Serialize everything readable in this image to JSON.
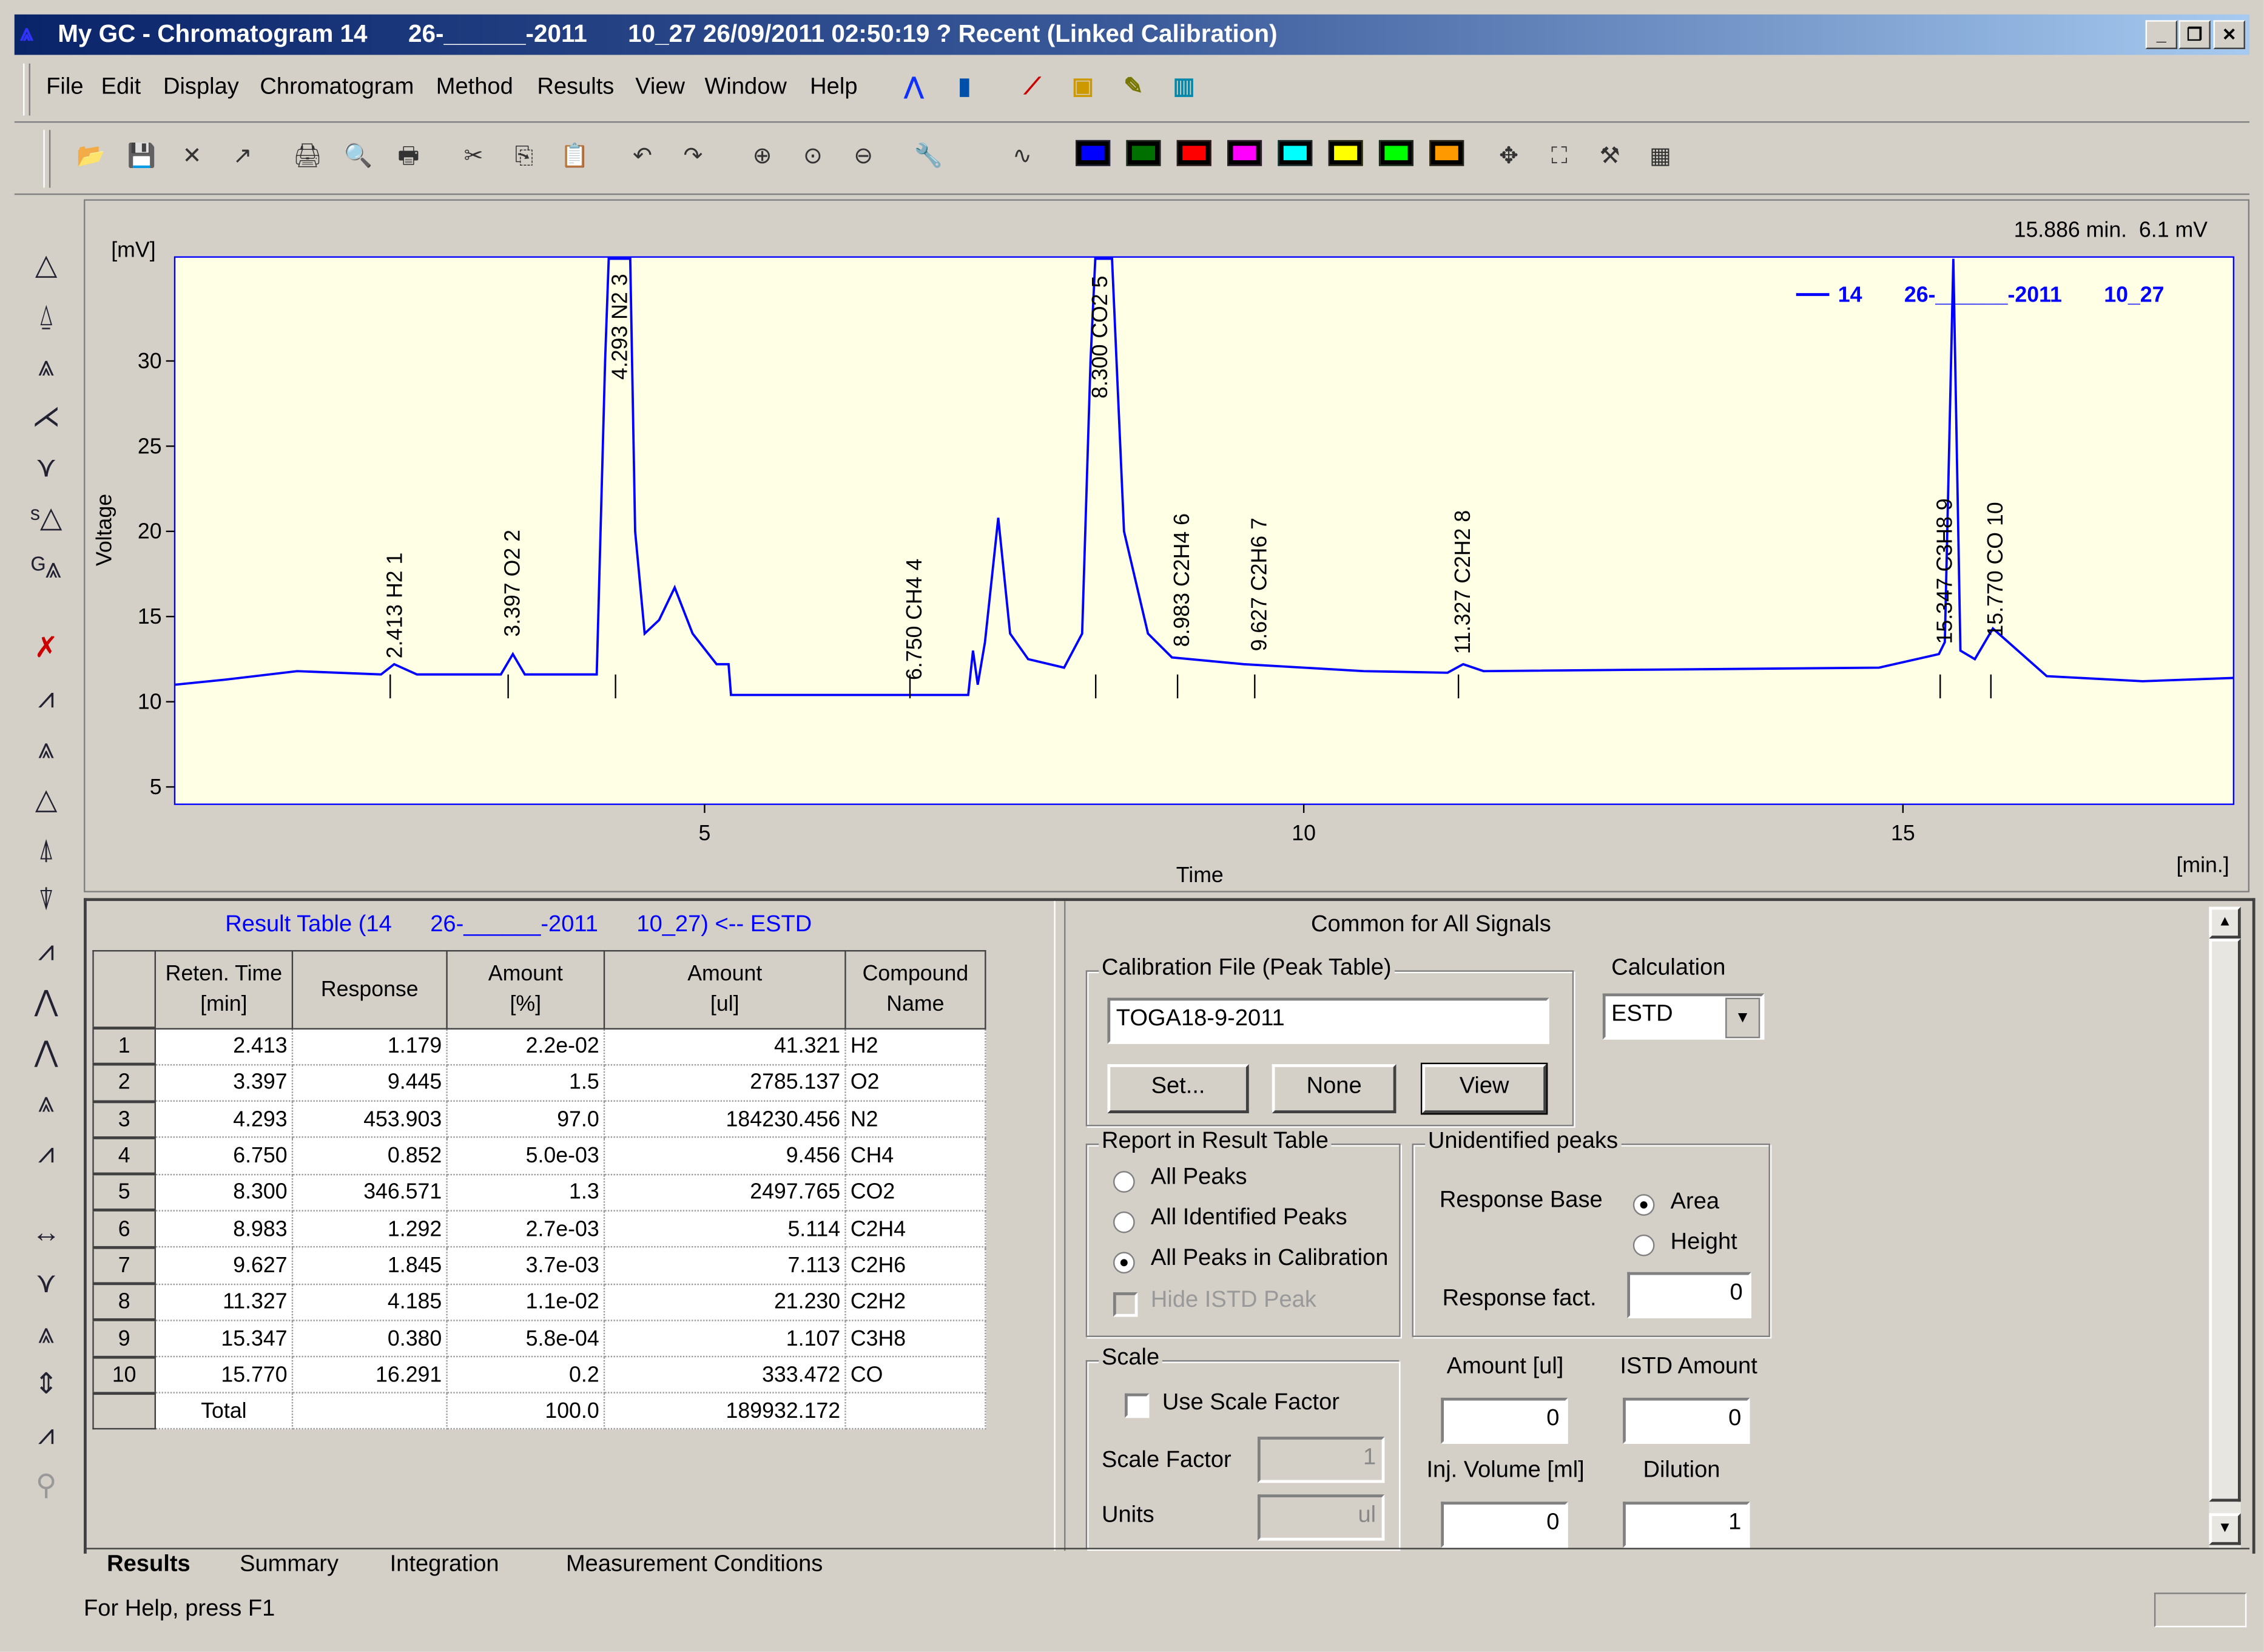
{
  "window": {
    "title": "My GC - Chromatogram 14      26-______-2011      10_27 26/09/2011 02:50:19 ? Recent (Linked Calibration)",
    "minimize": "_",
    "restore": "❐",
    "close": "✕"
  },
  "menu": [
    "File",
    "Edit",
    "Display",
    "Chromatogram",
    "Method",
    "Results",
    "View",
    "Window",
    "Help"
  ],
  "menu_icons": [
    "chromatogram-view-icon",
    "bar-chart-icon",
    "overlay-icon",
    "monitor-icon",
    "edit-method-icon",
    "instrument-icon"
  ],
  "toolbar": {
    "icons": [
      "open-icon",
      "save-icon",
      "delete-icon",
      "export-icon",
      "print-setup-icon",
      "print-preview-icon",
      "print-icon",
      "cut-icon",
      "copy-icon",
      "paste-icon",
      "undo-icon",
      "redo-icon",
      "zoom-in-icon",
      "zoom-icon",
      "zoom-reset-icon",
      "wrench-icon",
      "signal-icon"
    ],
    "color_boxes": [
      "#0000ff",
      "#007000",
      "#ff0000",
      "#ff00ff",
      "#00ffff",
      "#ffff00",
      "#00ff00",
      "#ff9900"
    ],
    "right_icons": [
      "move-icon",
      "fit-icon",
      "tools-icon",
      "table-icon"
    ]
  },
  "left_toolbar": [
    "peak-start-icon",
    "peak-end-icon",
    "split-peak-icon",
    "valley-icon",
    "negative-peak-icon",
    "solvent-peak-icon",
    "group-peak-icon",
    "delete-peak-icon",
    "manual-peak-icon",
    "lock-peak-icon",
    "baseline-icon",
    "forward-horizontal-icon",
    "backward-horizontal-icon",
    "tangent-icon",
    "front-tangent-icon",
    "tail-tangent-icon",
    "integration-event-icon",
    "shift-event-icon",
    "width-icon",
    "negative-baseline-icon",
    "threshold-icon",
    "min-height-icon",
    "noise-icon",
    "disabled-tool-icon"
  ],
  "chart": {
    "cursor_readout": "15.886 min.  6.1 mV",
    "y_unit": "[mV]",
    "y_label": "Voltage",
    "x_label": "Time",
    "x_unit": "[min.]",
    "legend": "14       26-______-2011       10_27",
    "trace_color": "#0000ff",
    "background": "#ffffe6",
    "y_ticks": [
      "5",
      "10",
      "15",
      "20",
      "25",
      "30"
    ],
    "x_ticks": [
      "5",
      "10",
      "15"
    ],
    "y_range": [
      4,
      36
    ],
    "x_range": [
      0.58,
      17.76
    ],
    "peaks": [
      {
        "rt": 2.413,
        "label": "2.413 H2 1"
      },
      {
        "rt": 3.397,
        "label": "3.397 O2 2"
      },
      {
        "rt": 4.293,
        "label": "4.293 N2 3"
      },
      {
        "rt": 6.75,
        "label": "6.750 CH4 4"
      },
      {
        "rt": 8.3,
        "label": "8.300 CO2 5"
      },
      {
        "rt": 8.983,
        "label": "8.983 C2H4 6"
      },
      {
        "rt": 9.627,
        "label": "9.627 C2H6 7"
      },
      {
        "rt": 11.327,
        "label": "11.327 C2H2 8"
      },
      {
        "rt": 15.347,
        "label": "15.347 C3H8 9"
      },
      {
        "rt": 15.77,
        "label": "15.770 CO 10"
      }
    ]
  },
  "result_table": {
    "title": "Result Table (14      26-______-2011      10_27) <-- ESTD",
    "headers": [
      "Reten. Time\n[min]",
      "Response",
      "Amount\n[%]",
      "Amount\n[ul]",
      "Compound\nName"
    ],
    "rows": [
      [
        "1",
        "2.413",
        "1.179",
        "2.2e-02",
        "41.321",
        "H2"
      ],
      [
        "2",
        "3.397",
        "9.445",
        "1.5",
        "2785.137",
        "O2"
      ],
      [
        "3",
        "4.293",
        "453.903",
        "97.0",
        "184230.456",
        "N2"
      ],
      [
        "4",
        "6.750",
        "0.852",
        "5.0e-03",
        "9.456",
        "CH4"
      ],
      [
        "5",
        "8.300",
        "346.571",
        "1.3",
        "2497.765",
        "CO2"
      ],
      [
        "6",
        "8.983",
        "1.292",
        "2.7e-03",
        "5.114",
        "C2H4"
      ],
      [
        "7",
        "9.627",
        "1.845",
        "3.7e-03",
        "7.113",
        "C2H6"
      ],
      [
        "8",
        "11.327",
        "4.185",
        "1.1e-02",
        "21.230",
        "C2H2"
      ],
      [
        "9",
        "15.347",
        "0.380",
        "5.8e-04",
        "1.107",
        "C3H8"
      ],
      [
        "10",
        "15.770",
        "16.291",
        "0.2",
        "333.472",
        "CO"
      ]
    ],
    "total": [
      "Total",
      "",
      "100.0",
      "189932.172",
      ""
    ]
  },
  "settings": {
    "header": "Common for All Signals",
    "calibration_group": "Calibration File (Peak Table)",
    "calibration_file": "TOGA18-9-2011",
    "set_button": "Set...",
    "none_button": "None",
    "view_button": "View",
    "calculation_label": "Calculation",
    "calculation_value": "ESTD",
    "report_group": "Report in Result Table",
    "report_options": [
      "All Peaks",
      "All Identified Peaks",
      "All Peaks in Calibration"
    ],
    "report_selected": 2,
    "hide_istd": "Hide ISTD Peak",
    "unidentified_group": "Unidentified peaks",
    "response_base_label": "Response Base",
    "response_base_options": [
      "Area",
      "Height"
    ],
    "response_base_selected": 0,
    "response_fact_label": "Response fact.",
    "response_fact": "0",
    "scale_group": "Scale",
    "use_scale_factor": "Use Scale Factor",
    "scale_factor_label": "Scale Factor",
    "scale_factor": "1",
    "units_label": "Units",
    "units": "ul",
    "amount_label": "Amount [ul]",
    "amount": "0",
    "istd_amount_label": "ISTD Amount",
    "istd_amount": "0",
    "inj_volume_label": "Inj. Volume [ml]",
    "inj_volume": "0",
    "dilution_label": "Dilution",
    "dilution": "1"
  },
  "tabs": [
    "Results",
    "Summary",
    "Integration",
    "Measurement Conditions"
  ],
  "active_tab": 0,
  "status": "For Help, press F1"
}
